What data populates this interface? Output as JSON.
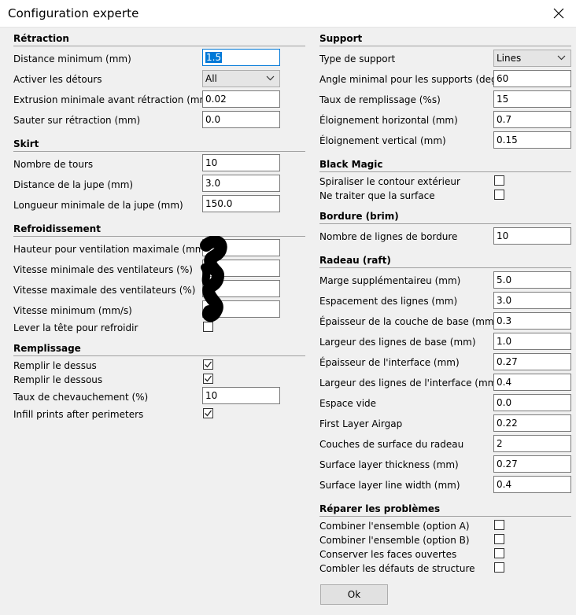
{
  "window": {
    "title": "Configuration experte"
  },
  "left": {
    "retraction": {
      "title": "Rétraction",
      "min_distance": {
        "label": "Distance minimum (mm)",
        "value": "1.5"
      },
      "detours": {
        "label": "Activer les détours",
        "value": "All"
      },
      "min_extrusion": {
        "label": "Extrusion minimale avant rétraction (mm)",
        "value": "0.02"
      },
      "z_hop": {
        "label": "Sauter sur rétraction (mm)",
        "value": "0.0"
      }
    },
    "skirt": {
      "title": "Skirt",
      "loops": {
        "label": "Nombre de tours",
        "value": "10"
      },
      "distance": {
        "label": "Distance de la jupe (mm)",
        "value": "3.0"
      },
      "min_length": {
        "label": "Longueur minimale de la jupe (mm)",
        "value": "150.0"
      }
    },
    "cooling": {
      "title": "Refroidissement",
      "fan_full_height": {
        "label": "Hauteur pour ventilation maximale (mm)",
        "value": ""
      },
      "fan_min_speed": {
        "label": "Vitesse minimale des ventilateurs (%)",
        "value": ""
      },
      "fan_max_speed": {
        "label": "Vitesse maximale des ventilateurs (%)",
        "value": ""
      },
      "min_speed": {
        "label": "Vitesse minimum (mm/s)",
        "value": ""
      },
      "lift_head": {
        "label": "Lever la tête pour refroidir",
        "checked": false
      }
    },
    "infill": {
      "title": "Remplissage",
      "fill_top": {
        "label": "Remplir le dessus",
        "checked": true
      },
      "fill_bottom": {
        "label": "Remplir le dessous",
        "checked": true
      },
      "overlap": {
        "label": "Taux de chevauchement (%)",
        "value": "10"
      },
      "after_perimeters": {
        "label": "Infill prints after perimeters",
        "checked": true
      }
    }
  },
  "right": {
    "support": {
      "title": "Support",
      "type": {
        "label": "Type de support",
        "value": "Lines"
      },
      "angle": {
        "label": "Angle minimal pour les supports (deg)",
        "value": "60"
      },
      "fill_rate": {
        "label": "Taux de remplissage (%s)",
        "value": "15"
      },
      "xy_distance": {
        "label": "Éloignement horizontal (mm)",
        "value": "0.7"
      },
      "z_distance": {
        "label": "Éloignement vertical (mm)",
        "value": "0.15"
      }
    },
    "black_magic": {
      "title": "Black Magic",
      "spiralize": {
        "label": "Spiraliser le contour extérieur",
        "checked": false
      },
      "surface_only": {
        "label": "Ne traiter que la surface",
        "checked": false
      }
    },
    "brim": {
      "title": "Bordure (brim)",
      "line_count": {
        "label": "Nombre de lignes de bordure",
        "value": "10"
      }
    },
    "raft": {
      "title": "Radeau (raft)",
      "margin": {
        "label": "Marge supplémentaireu (mm)",
        "value": "5.0"
      },
      "line_spacing": {
        "label": "Espacement des lignes (mm)",
        "value": "3.0"
      },
      "base_thickness": {
        "label": "Épaisseur de la couche de base (mm)",
        "value": "0.3"
      },
      "base_linewidth": {
        "label": "Largeur des lignes de base (mm)",
        "value": "1.0"
      },
      "interface_thickness": {
        "label": "Épaisseur de l'interface (mm)",
        "value": "0.27"
      },
      "interface_linewidth": {
        "label": "Largeur des lignes de l'interface (mm)",
        "value": "0.4"
      },
      "airgap": {
        "label": "Espace vide",
        "value": "0.0"
      },
      "first_layer_airgap": {
        "label": "First Layer Airgap",
        "value": "0.22"
      },
      "surface_layers": {
        "label": "Couches de surface du radeau",
        "value": "2"
      },
      "surface_thickness": {
        "label": "Surface layer thickness (mm)",
        "value": "0.27"
      },
      "surface_linewidth": {
        "label": "Surface layer line width (mm)",
        "value": "0.4"
      }
    },
    "fix": {
      "title": "Réparer les problèmes",
      "combine_a": {
        "label": "Combiner l'ensemble (option A)",
        "checked": false
      },
      "combine_b": {
        "label": "Combiner l'ensemble (option B)",
        "checked": false
      },
      "keep_open": {
        "label": "Conserver les faces ouvertes",
        "checked": false
      },
      "extensive_stitch": {
        "label": "Combler les défauts de structure",
        "checked": false
      }
    }
  },
  "buttons": {
    "ok": "Ok"
  },
  "icons": {
    "close": "close-icon",
    "dropdown": "chevron-down-icon",
    "check": "checkmark-icon"
  }
}
